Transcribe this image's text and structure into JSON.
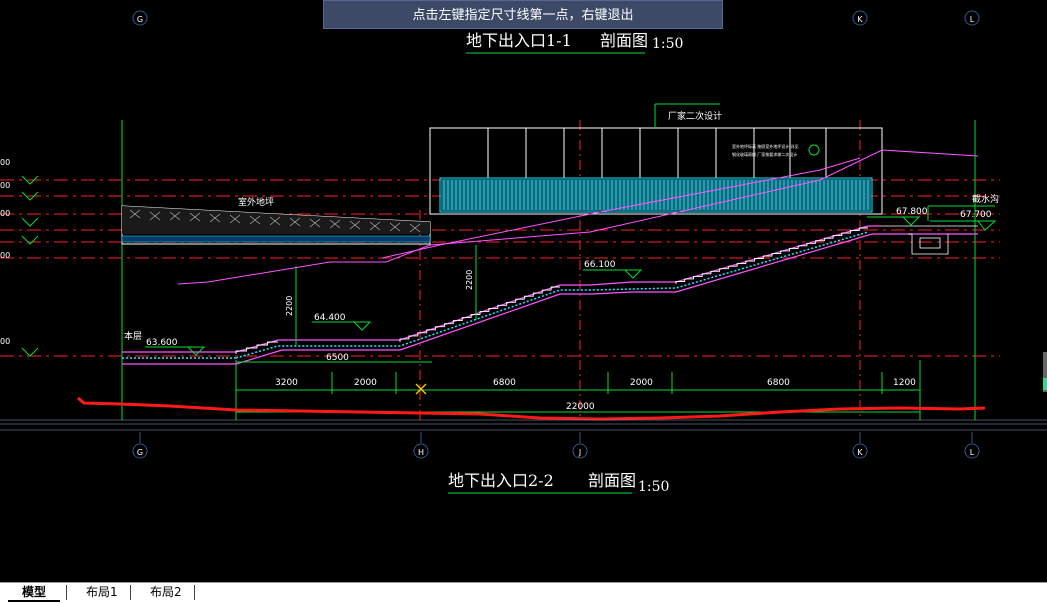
{
  "prompt": {
    "text": "点击左键指定尺寸线第一点，右键退出"
  },
  "tabs": [
    {
      "label": "模型",
      "active": true
    },
    {
      "label": "布局1",
      "active": false
    },
    {
      "label": "布局2",
      "active": false
    }
  ],
  "drawing": {
    "section_top": {
      "title": "地下出入口1-1",
      "view": "剖面图",
      "scale": "1:50"
    },
    "section_bottom": {
      "title": "地下出入口2-2",
      "view": "剖面图",
      "scale": "1:50"
    },
    "grid_labels": [
      "G",
      "H",
      "J",
      "K",
      "L"
    ],
    "labels": {
      "outdoor_ground": "室外地坪",
      "vendor_design": "厂家二次设计",
      "drain": "截水沟",
      "left_note": "本层",
      "fine_note_1": "室外地坪标高  按照室外地坪设计  详见",
      "fine_note_2": "钢化玻璃雨棚  厂家按要求做二次设计"
    },
    "elevations": {
      "e1": "63.600",
      "e2": "64.400",
      "e3": "66.100",
      "e4": "67.800",
      "e5": "67.700"
    },
    "level_stubs": [
      "00",
      "00",
      "00",
      "00",
      "00"
    ],
    "vertical_dims": [
      "2200",
      "2200"
    ],
    "dim_6500": "6500",
    "dims_row": [
      "3200",
      "2000",
      "6800",
      "2000",
      "6800",
      "1200"
    ],
    "dim_total": "22000"
  },
  "colors": {
    "background": "#000000",
    "level_line": "#ff2020",
    "grid_line": "#00dd33",
    "stair": "#ff55ff",
    "glazing": "#22e6ff",
    "bubble": "#2b5a8a",
    "red_polyline": "#ff1a1a"
  }
}
